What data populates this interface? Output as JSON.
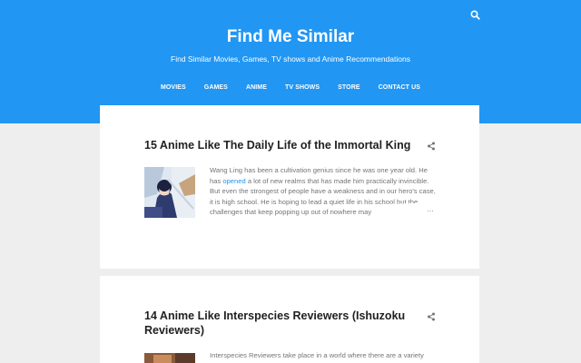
{
  "header": {
    "title": "Find Me Similar",
    "description": "Find Similar Movies, Games, TV shows and Anime Recommendations",
    "search_icon": "search-icon",
    "background_color": "#2196f3"
  },
  "nav": {
    "items": [
      {
        "label": "MOVIES"
      },
      {
        "label": "GAMES"
      },
      {
        "label": "ANIME"
      },
      {
        "label": "TV SHOWS"
      },
      {
        "label": "STORE"
      },
      {
        "label": "CONTACT US"
      }
    ]
  },
  "posts": [
    {
      "title": "15 Anime Like The Daily Life of the Immortal King",
      "snippet_before_link": "Wang Ling has been a cultivation genius since he was one year old. He has ",
      "snippet_link": "opened",
      "snippet_after_link": " a lot of new realms that has made him practically invincible. But even the strongest of people have a weakness and in our hero's case, it is high school. He is hoping to lead a quiet life in his school but the challenges that keep popping up out of nowhere may",
      "ellipsis": "…",
      "share_icon": "share-icon"
    },
    {
      "title": "14 Anime Like Interspecies Reviewers (Ishuzoku Reviewers)",
      "snippet": "Interspecies Reviewers take place in a world where there are a variety",
      "share_icon": "share-icon"
    }
  ]
}
